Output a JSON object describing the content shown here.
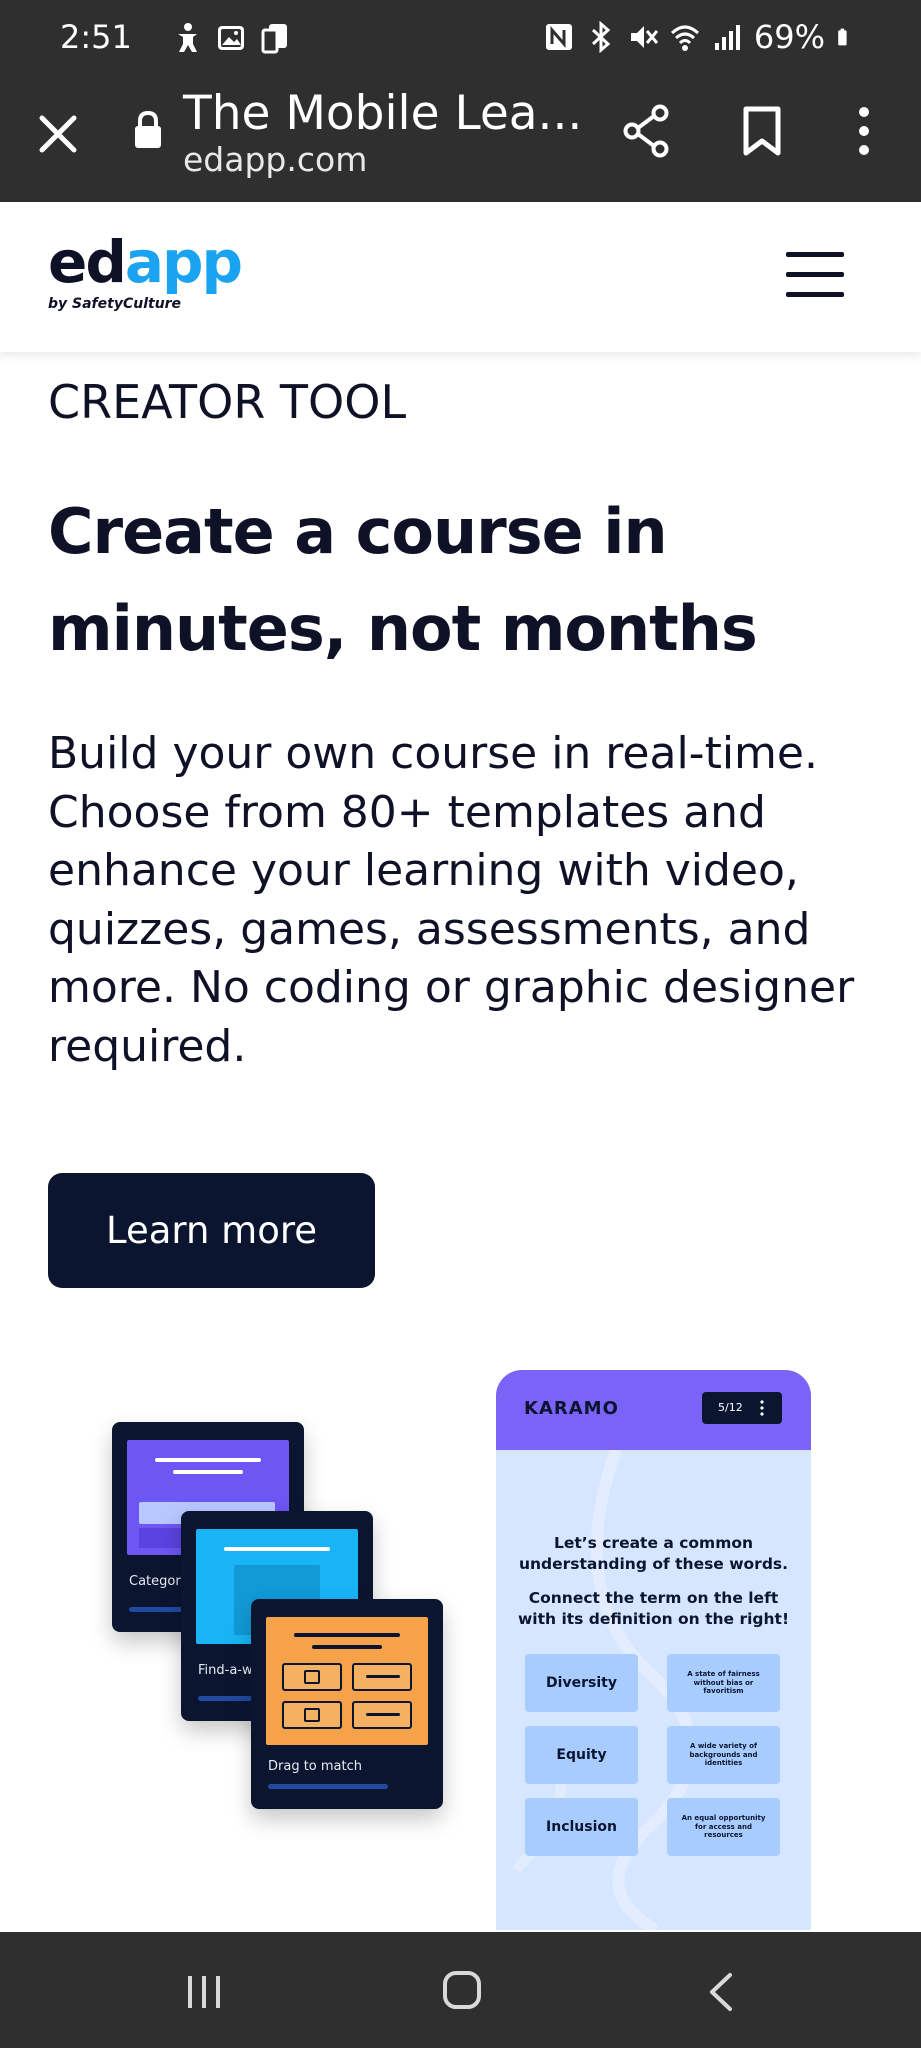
{
  "status_bar": {
    "time": "2:51",
    "battery": "69%",
    "icons": [
      "accessibility-icon",
      "image-icon",
      "copy-icon",
      "nfc-icon",
      "bluetooth-icon",
      "mute-icon",
      "wifi-icon",
      "signal-icon",
      "battery-icon"
    ]
  },
  "browser": {
    "tab_title": "The Mobile Lea...",
    "url": "edapp.com",
    "icons": [
      "close-icon",
      "lock-icon",
      "share-icon",
      "bookmark-icon",
      "more-vert-icon"
    ]
  },
  "site_header": {
    "logo_primary": "ed",
    "logo_accent": "app",
    "logo_tagline": "by SafetyCulture",
    "menu_icon": "hamburger-menu-icon"
  },
  "hero": {
    "eyebrow": "CREATOR TOOL",
    "headline": "Create a course in minutes, not months",
    "body": "Build your own course in real-time. Choose from 80+ templates and enhance your learning with video, quizzes, games, assessments, and more. No coding or graphic designer required.",
    "cta_label": "Learn more"
  },
  "illustration": {
    "cards": [
      {
        "label": "Categori"
      },
      {
        "label": "Find-a-w"
      },
      {
        "label": "Drag to match"
      }
    ],
    "phone": {
      "brand": "KARAMO",
      "counter": "5/12",
      "prompt_1": "Let’s create a common understanding of these words.",
      "prompt_2": "Connect the term on the left with its definition on the right!",
      "terms": [
        "Diversity",
        "Equity",
        "Inclusion"
      ],
      "definitions": [
        "A state of fairness without bias or favoritism",
        "A wide variety of backgrounds and identities",
        "An equal opportunity for access and resources"
      ]
    }
  },
  "nav_bar": {
    "icons": [
      "recents-icon",
      "home-icon",
      "back-icon"
    ]
  },
  "colors": {
    "system_bar": "#2f2f2f",
    "brand_dark": "#0f1226",
    "brand_blue": "#1aa3f0",
    "button_bg": "#0b1530",
    "purple": "#7a63f6",
    "cyan": "#19b4f5",
    "orange": "#f6a24a",
    "phone_bg": "#d6e6ff",
    "term_bg": "#a9ccff"
  }
}
